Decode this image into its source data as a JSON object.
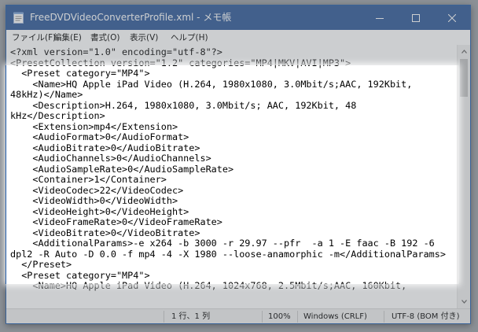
{
  "window": {
    "title": "FreeDVDVideoConverterProfile.xml - メモ帳"
  },
  "menu": [
    {
      "label": "ファイル(F)"
    },
    {
      "label": "編集(E)"
    },
    {
      "label": "書式(O)"
    },
    {
      "label": "表示(V)"
    },
    {
      "label": "ヘルプ(H)"
    }
  ],
  "editor": {
    "lines": [
      "<?xml version=\"1.0\" encoding=\"utf-8\"?>",
      "<PresetCollection version=\"1.2\" categories=\"MP4|MKV|AVI|MP3\">",
      "  <Preset category=\"MP4\">",
      "    <Name>HQ Apple iPad Video (H.264, 1980x1080, 3.0Mbit/s;AAC, 192Kbit,",
      "48kHz)</Name>",
      "    <Description>H.264, 1980x1080, 3.0Mbit/s; AAC, 192Kbit, 48",
      "kHz</Description>",
      "    <Extension>mp4</Extension>",
      "    <AudioFormat>0</AudioFormat>",
      "    <AudioBitrate>0</AudioBitrate>",
      "    <AudioChannels>0</AudioChannels>",
      "    <AudioSampleRate>0</AudioSampleRate>",
      "    <Container>1</Container>",
      "    <VideoCodec>22</VideoCodec>",
      "    <VideoWidth>0</VideoWidth>",
      "    <VideoHeight>0</VideoHeight>",
      "    <VideoFrameRate>0</VideoFrameRate>",
      "    <VideoBitrate>0</VideoBitrate>",
      "    <AdditionalParams>-e x264 -b 3000 -r 29.97 --pfr  -a 1 -E faac -B 192 -6",
      "dpl2 -R Auto -D 0.0 -f mp4 -4 -X 1980 --loose-anamorphic -m</AdditionalParams>",
      "  </Preset>",
      "  <Preset category=\"MP4\">",
      "    <Name>HQ Apple iPad Video (H.264, 1024x768, 2.5Mbit/s;AAC, 160Kbit,"
    ]
  },
  "status": {
    "position": "1 行、1 列",
    "zoom": "100%",
    "line_ending": "Windows (CRLF)",
    "encoding": "UTF-8 (BOM 付き)"
  },
  "colors": {
    "titlebar": "#2b5797",
    "window_border": "#1e5aa8",
    "desktop": "#9ca0a6"
  }
}
